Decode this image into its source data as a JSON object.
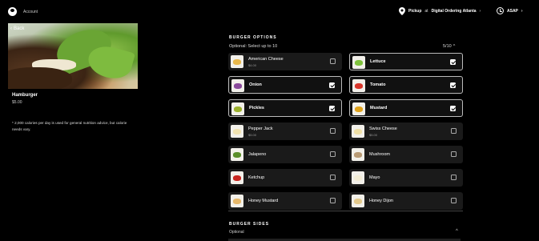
{
  "header": {
    "account_label": "Account",
    "pickup_prefix": "Pickup",
    "pickup_at": "at",
    "pickup_location": "Digital Ordering Atlanta",
    "pickup_chevron": "›",
    "asap_label": "ASAP",
    "asap_chevron": "›"
  },
  "left": {
    "back_label": "Back",
    "back_chevron": "‹",
    "item_name": "Hamburger",
    "item_price": "$5.00",
    "calorie_note": "* 2,000 calories per day is used for general nutrition advice, but calorie needs vary."
  },
  "options_section": {
    "title": "BURGER OPTIONS",
    "subtitle": "Optional: Select up to 10",
    "count": "5/10",
    "collapse_chevron": "^",
    "items": [
      {
        "label": "American Cheese",
        "price": "$4.00",
        "selected": false,
        "thumb_color": "#e9b84a"
      },
      {
        "label": "Lettuce",
        "price": "",
        "selected": true,
        "thumb_color": "#7fc23c"
      },
      {
        "label": "Onion",
        "price": "",
        "selected": true,
        "thumb_color": "#8a4a9a"
      },
      {
        "label": "Tomato",
        "price": "",
        "selected": true,
        "thumb_color": "#d8352a"
      },
      {
        "label": "Pickles",
        "price": "",
        "selected": true,
        "thumb_color": "#9bb02c"
      },
      {
        "label": "Mustard",
        "price": "",
        "selected": true,
        "thumb_color": "#e0a21b"
      },
      {
        "label": "Pepper Jack",
        "price": "$5.00",
        "selected": false,
        "thumb_color": "#f1e3b0"
      },
      {
        "label": "Swiss Cheese",
        "price": "$5.00",
        "selected": false,
        "thumb_color": "#efe0a6"
      },
      {
        "label": "Jalapeno",
        "price": "",
        "selected": false,
        "thumb_color": "#5b8e2a"
      },
      {
        "label": "Mushroom",
        "price": "",
        "selected": false,
        "thumb_color": "#b89a74"
      },
      {
        "label": "Ketchup",
        "price": "",
        "selected": false,
        "thumb_color": "#c8261f"
      },
      {
        "label": "Mayo",
        "price": "",
        "selected": false,
        "thumb_color": "#f3ecd4"
      },
      {
        "label": "Honey Mustard",
        "price": "",
        "selected": false,
        "thumb_color": "#e6b86a"
      },
      {
        "label": "Honey Dijon",
        "price": "",
        "selected": false,
        "thumb_color": "#e3c98c"
      }
    ]
  },
  "sides_section": {
    "title": "BURGER SIDES",
    "subtitle": "Optional",
    "collapse_chevron": "^"
  }
}
